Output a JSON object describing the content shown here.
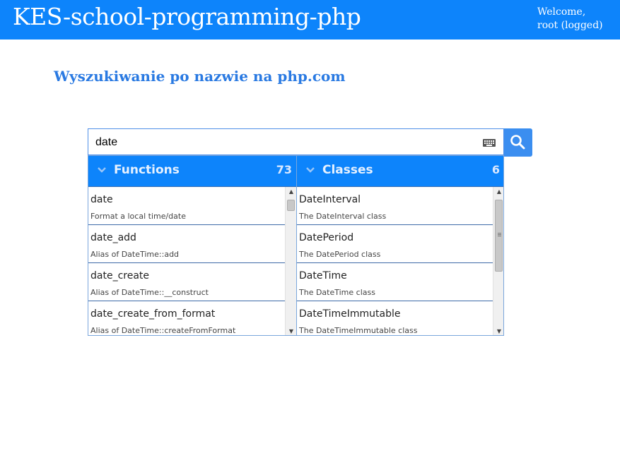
{
  "header": {
    "app_title": "KES-school-programming-php",
    "welcome_line1": "Welcome,",
    "welcome_line2": "root (logged)"
  },
  "page": {
    "heading": "Wyszukiwanie po nazwie na php.com"
  },
  "search": {
    "value": "date",
    "keyboard_icon": "keyboard-icon",
    "button_icon": "search-icon"
  },
  "results": {
    "functions": {
      "label": "Functions",
      "count": "73",
      "items": [
        {
          "name": "date",
          "desc": "Format a local time/date"
        },
        {
          "name": "date_add",
          "desc": "Alias of DateTime::add"
        },
        {
          "name": "date_create",
          "desc": "Alias of DateTime::__construct"
        },
        {
          "name": "date_create_from_format",
          "desc": "Alias of DateTime::createFromFormat"
        }
      ]
    },
    "classes": {
      "label": "Classes",
      "count": "6",
      "items": [
        {
          "name": "DateInterval",
          "desc": "The DateInterval class"
        },
        {
          "name": "DatePeriod",
          "desc": "The DatePeriod class"
        },
        {
          "name": "DateTime",
          "desc": "The DateTime class"
        },
        {
          "name": "DateTimeImmutable",
          "desc": "The DateTimeImmutable class"
        }
      ]
    }
  },
  "colors": {
    "header_bg": "#0d84fb",
    "heading_text": "#2a7ae2",
    "search_button_bg": "#3b8ef0"
  }
}
